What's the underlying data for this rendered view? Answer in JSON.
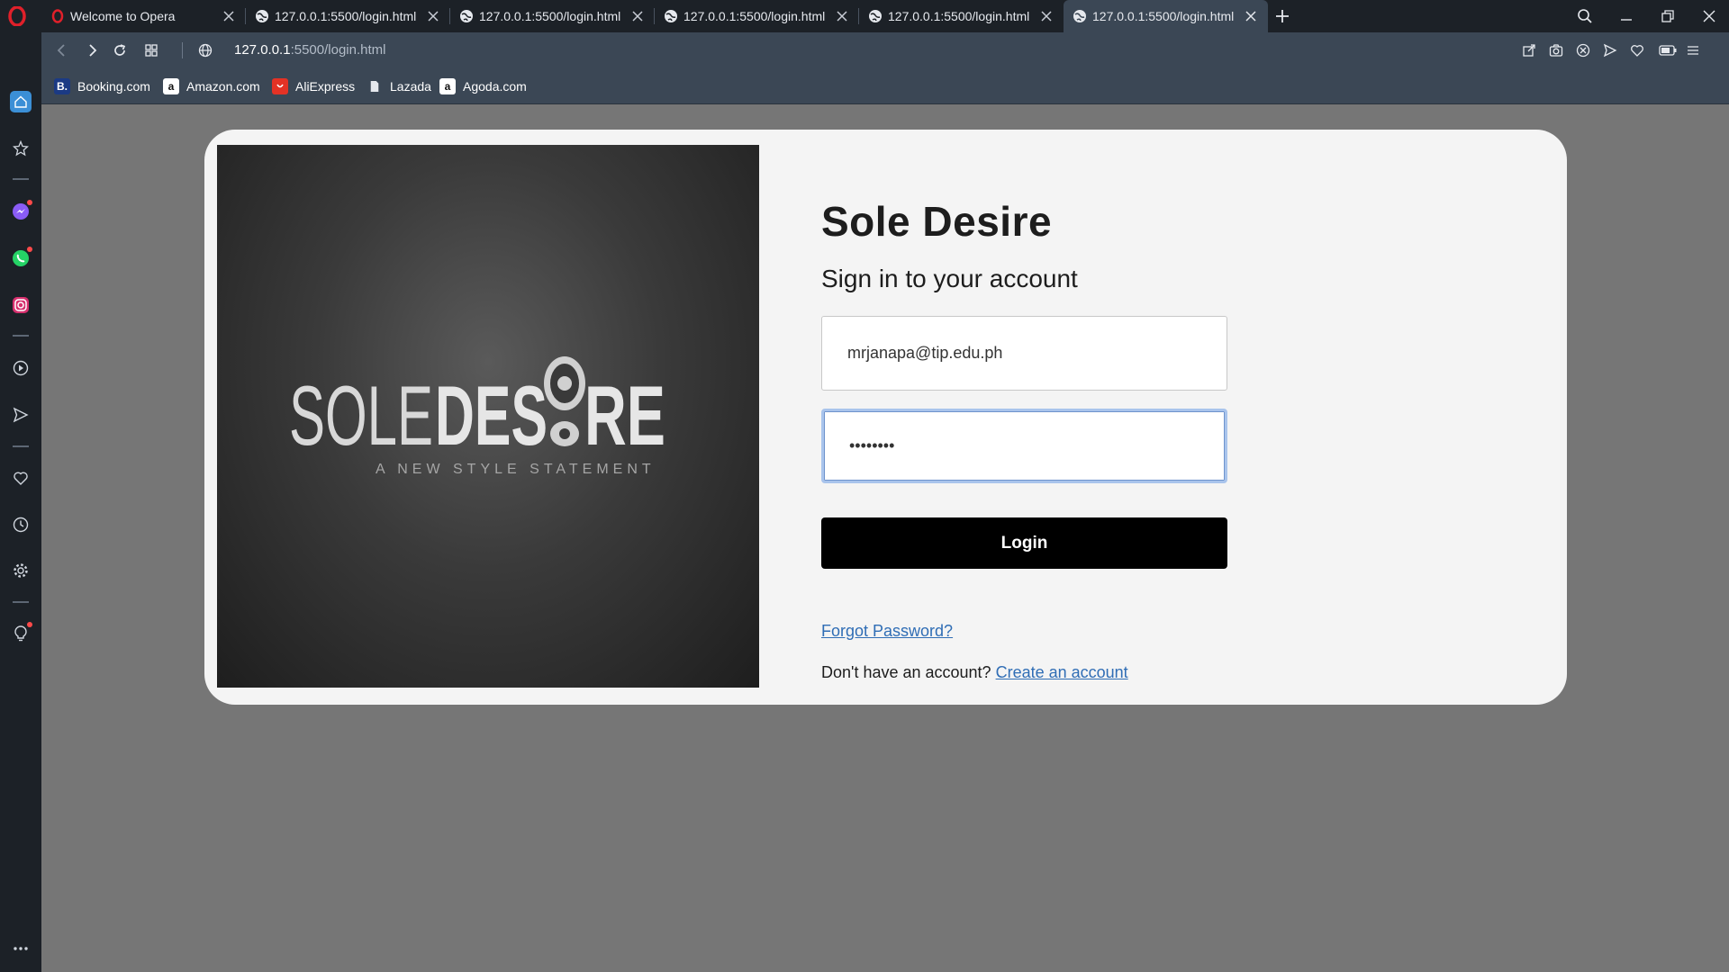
{
  "browser": {
    "tabs": [
      {
        "title": "Welcome to Opera",
        "favicon": "opera-icon",
        "active": false
      },
      {
        "title": "127.0.0.1:5500/login.html",
        "favicon": "globe-icon",
        "active": false
      },
      {
        "title": "127.0.0.1:5500/login.html",
        "favicon": "globe-icon",
        "active": false
      },
      {
        "title": "127.0.0.1:5500/login.html",
        "favicon": "globe-icon",
        "active": false
      },
      {
        "title": "127.0.0.1:5500/login.html",
        "favicon": "globe-icon",
        "active": false
      },
      {
        "title": "127.0.0.1:5500/login.html",
        "favicon": "globe-icon",
        "active": true
      }
    ],
    "address": {
      "host": "127.0.0.1",
      "rest": ":5500/login.html"
    },
    "bookmarks": [
      {
        "label": "Booking.com",
        "icon": "B."
      },
      {
        "label": "Amazon.com",
        "icon": "a"
      },
      {
        "label": "AliExpress",
        "icon": "ali"
      },
      {
        "label": "Lazada",
        "icon": "doc"
      },
      {
        "label": "Agoda.com",
        "icon": "a"
      }
    ],
    "sidebar_icons": [
      "home-icon",
      "star-icon",
      "messenger-icon",
      "whatsapp-icon",
      "instagram-icon",
      "player-icon",
      "send-icon",
      "heart-icon",
      "history-icon",
      "settings-icon",
      "lightbulb-icon",
      "more-icon"
    ],
    "colors": {
      "tabbar": "#1c2127",
      "toolbar": "#3b4755",
      "opera_red": "#e0202a"
    }
  },
  "page": {
    "logo": {
      "word1": "SOLE",
      "word2a": "DES",
      "word2b": "RE",
      "tagline": "A NEW STYLE STATEMENT"
    },
    "title": "Sole Desire",
    "subtitle": "Sign in to your account",
    "email_value": "mrjanapa@tip.edu.ph",
    "password_value": "••••••••",
    "login_label": "Login",
    "forgot_label": "Forgot Password?",
    "no_account_text": "Don't have an account?",
    "create_label": "Create an account",
    "colors": {
      "background": "#767676",
      "card": "#f4f4f4",
      "button": "#000000",
      "link": "#2f6db5"
    }
  }
}
